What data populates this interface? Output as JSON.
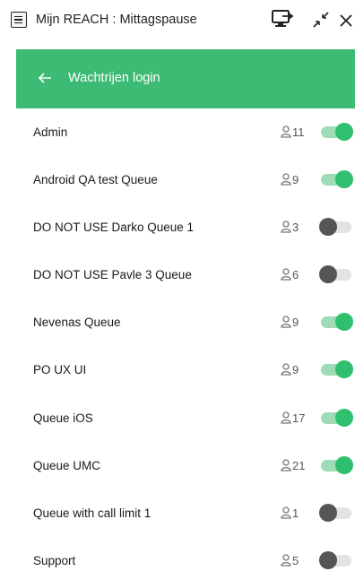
{
  "titlebar": {
    "title": "Mijn REACH : Mittagspause",
    "icons": [
      "menu-icon",
      "monitor-icon",
      "minimize-icon",
      "close-icon"
    ]
  },
  "header": {
    "title": "Wachtrijen login",
    "background": "#3dbb74"
  },
  "colors": {
    "toggle_on_knob": "#2fbf6e",
    "toggle_on_track": "#9ddcb6",
    "toggle_off_knob": "#555555",
    "toggle_off_track": "#e3e3e3"
  },
  "queues": [
    {
      "name": "Admin",
      "count": "11",
      "enabled": true
    },
    {
      "name": "Android QA test Queue",
      "count": "9",
      "enabled": true
    },
    {
      "name": "DO NOT USE Darko Queue 1",
      "count": "3",
      "enabled": false
    },
    {
      "name": "DO NOT USE Pavle 3 Queue",
      "count": "6",
      "enabled": false
    },
    {
      "name": "Nevenas Queue",
      "count": "9",
      "enabled": true
    },
    {
      "name": "PO UX UI",
      "count": "9",
      "enabled": true
    },
    {
      "name": "Queue iOS",
      "count": "17",
      "enabled": true
    },
    {
      "name": "Queue UMC",
      "count": "21",
      "enabled": true
    },
    {
      "name": "Queue with call limit 1",
      "count": "1",
      "enabled": false
    },
    {
      "name": "Support",
      "count": "5",
      "enabled": false
    }
  ]
}
